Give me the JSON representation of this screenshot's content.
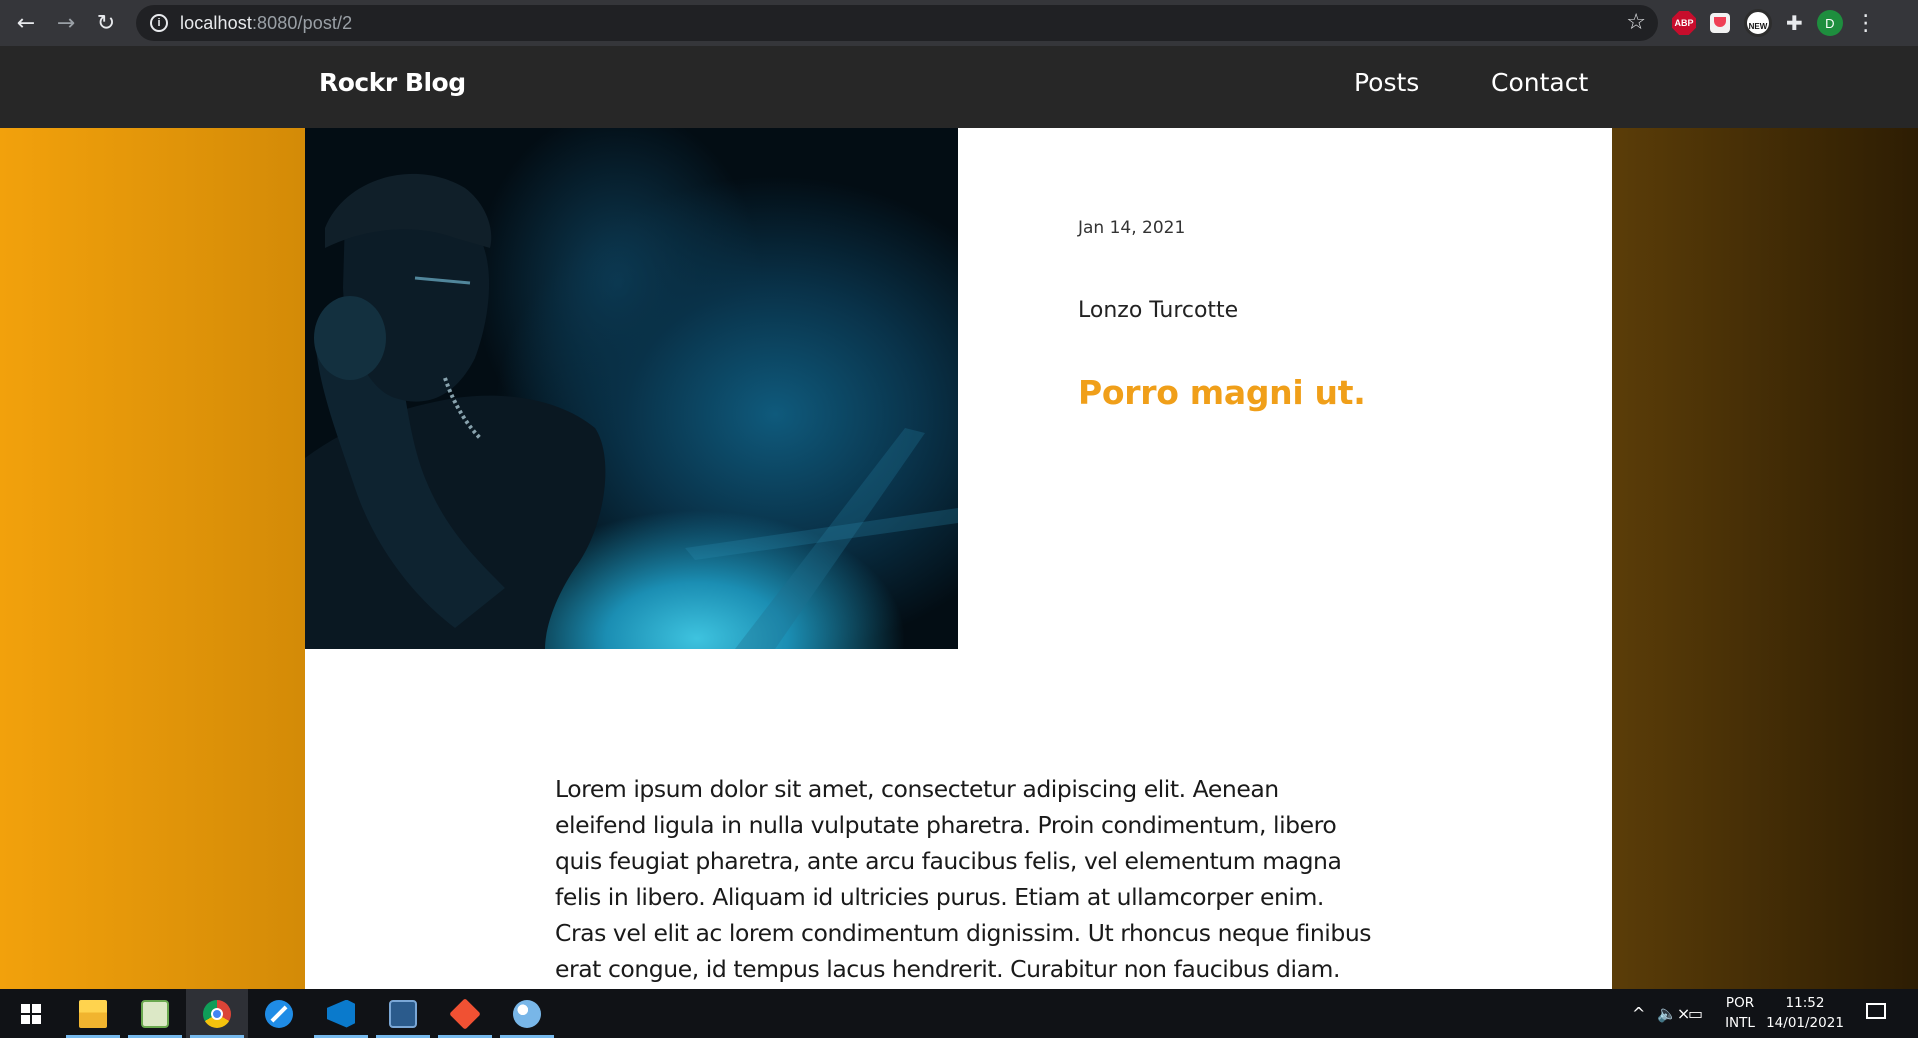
{
  "browser": {
    "url_host": "localhost",
    "url_path": ":8080/post/2",
    "profile_initial": "D",
    "extensions": [
      "ABP",
      "pocket",
      "NEW"
    ]
  },
  "site": {
    "brand": "Rockr Blog",
    "nav": {
      "posts": "Posts",
      "contact": "Contact"
    }
  },
  "post": {
    "date": "Jan 14, 2021",
    "author": "Lonzo Turcotte",
    "title": "Porro magni ut.",
    "body": "Lorem ipsum dolor sit amet, consectetur adipiscing elit. Aenean eleifend ligula in nulla vulputate pharetra. Proin condimentum, libero quis feugiat pharetra, ante arcu faucibus felis, vel elementum magna felis in libero. Aliquam id ultricies purus. Etiam at ullamcorper enim. Cras vel elit ac lorem condimentum dignissim. Ut rhoncus neque finibus erat congue, id tempus lacus hendrerit. Curabitur non faucibus diam. Sed id ante id dolor"
  },
  "colors": {
    "accent": "#f09f19",
    "nav_bg": "#272727"
  },
  "taskbar": {
    "apps": [
      "windows-start",
      "file-explorer",
      "notepad",
      "chrome",
      "safari",
      "vscode",
      "mysql-workbench",
      "git",
      "paint"
    ],
    "lang_top": "POR",
    "lang_bottom": "INTL",
    "time": "11:52",
    "date": "14/01/2021"
  }
}
